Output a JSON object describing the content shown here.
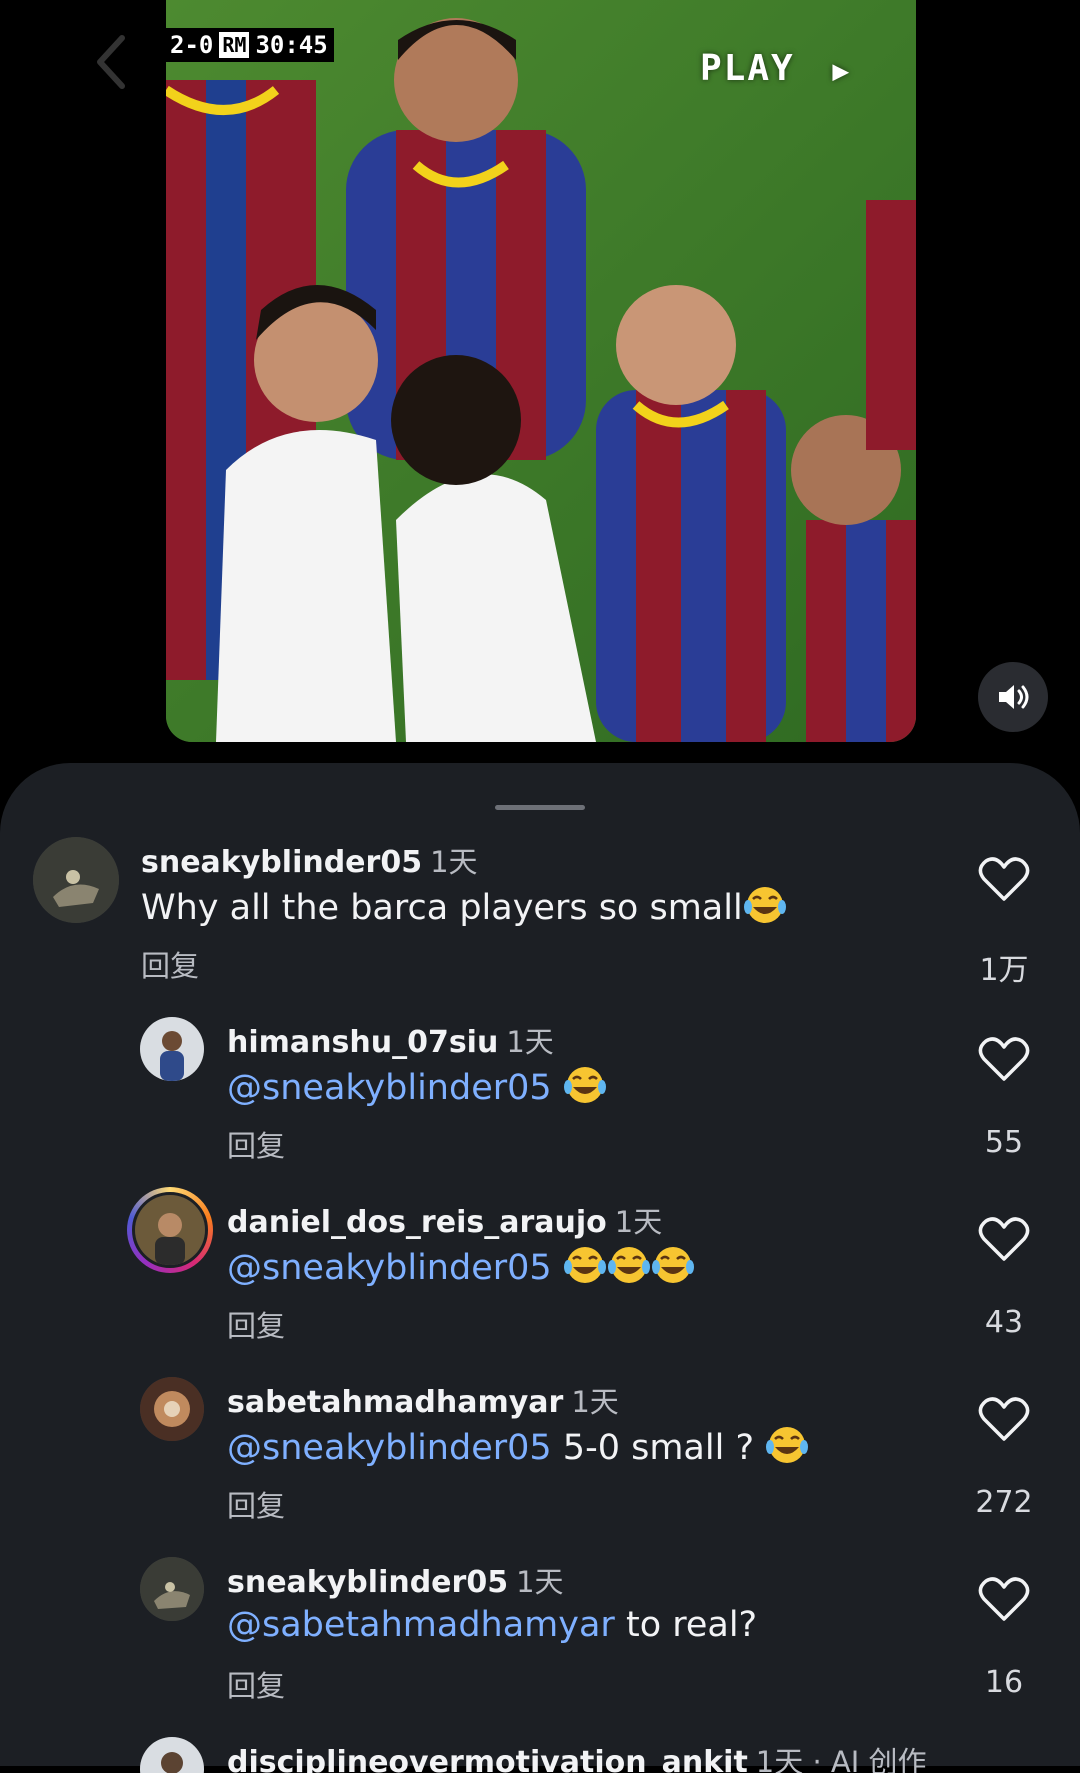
{
  "video": {
    "scorebug": {
      "score": "2-0",
      "team": "RM",
      "clock": "30:45"
    },
    "play_label": "PLAY",
    "play_arrow": "▶"
  },
  "comments": [
    {
      "username": "sneakyblinder05",
      "time": "1天",
      "mention": "",
      "text": "Why all the barca players so small",
      "emoji_count": 1,
      "reply_label": "回复",
      "likes": "1万"
    },
    {
      "username": "himanshu_07siu",
      "time": "1天",
      "mention": "@sneakyblinder05",
      "text": "",
      "emoji_count": 1,
      "reply_label": "回复",
      "likes": "55"
    },
    {
      "username": "daniel_dos_reis_araujo",
      "time": "1天",
      "mention": "@sneakyblinder05",
      "text": "",
      "emoji_count": 3,
      "reply_label": "回复",
      "likes": "43"
    },
    {
      "username": "sabetahmadhamyar",
      "time": "1天",
      "mention": "@sneakyblinder05",
      "text": "5-0 small ?",
      "emoji_count": 1,
      "reply_label": "回复",
      "likes": "272"
    },
    {
      "username": "sneakyblinder05",
      "time": "1天",
      "mention": "@sabetahmadhamyar",
      "text": "to real?",
      "emoji_count": 0,
      "reply_label": "回复",
      "likes": "16"
    },
    {
      "username": "disciplineovermotivation_ankit",
      "time": "1天 · AI 创作",
      "mention": "",
      "text": "",
      "emoji_count": 0,
      "reply_label": "",
      "likes": ""
    }
  ],
  "colors": {
    "mention": "#7fb0ff",
    "sheet_bg": "#1c1f24",
    "muted": "#b8bbc2"
  },
  "icons": {
    "like": "heart-outline-icon",
    "volume": "speaker-icon",
    "back": "chevron-left-icon"
  }
}
